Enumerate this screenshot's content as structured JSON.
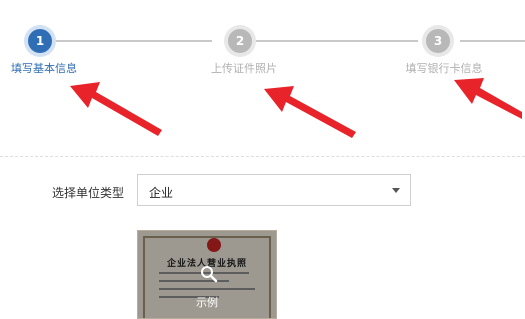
{
  "steps": [
    {
      "number": "1",
      "label": "填写基本信息",
      "state": "active"
    },
    {
      "number": "2",
      "label": "上传证件照片",
      "state": "inactive"
    },
    {
      "number": "3",
      "label": "填写银行卡信息",
      "state": "inactive"
    }
  ],
  "form": {
    "unit_type_label": "选择单位类型",
    "unit_type_value": "企业"
  },
  "sample": {
    "cert_title": "企业法人营业执照",
    "overlay_text": "示例"
  },
  "colors": {
    "active_step": "#2f6eb5",
    "inactive_step": "#b8b8b8",
    "annotation_arrow": "#e8232a"
  },
  "icons": {
    "select_caret": "chevron-down-icon",
    "sample_zoom": "magnifier-icon"
  }
}
